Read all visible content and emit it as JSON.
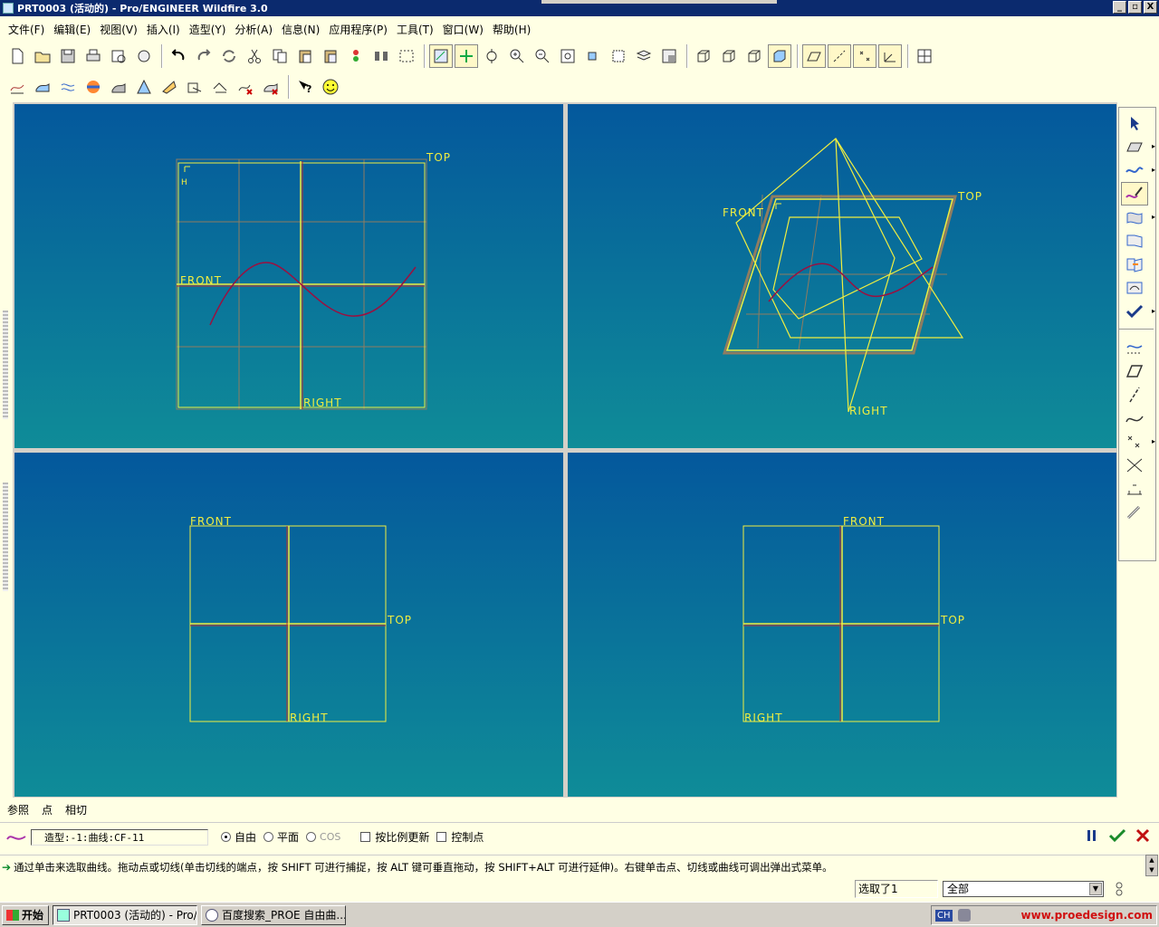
{
  "window": {
    "title": "PRT0003 (活动的) - Pro/ENGINEER Wildfire 3.0",
    "controls": [
      "_",
      "▫",
      "X"
    ]
  },
  "menu": [
    "文件(F)",
    "编辑(E)",
    "视图(V)",
    "插入(I)",
    "造型(Y)",
    "分析(A)",
    "信息(N)",
    "应用程序(P)",
    "工具(T)",
    "窗口(W)",
    "帮助(H)"
  ],
  "toolbar_icons": {
    "row1": [
      "new-file",
      "open-file",
      "save",
      "print",
      "print-preview",
      "email",
      "undo",
      "redo",
      "regenerate",
      "cut",
      "copy",
      "paste",
      "paste-special",
      "regenerate-model",
      "find",
      "selection-box",
      "refit",
      "repaint",
      "orient",
      "zoom-in",
      "zoom-out",
      "zoom-fit",
      "spin-center",
      "named-view",
      "layers",
      "view-manager",
      "wireframe",
      "hidden-line",
      "no-hidden",
      "shaded",
      "datum-planes",
      "datum-axes",
      "datum-points",
      "coordinate-systems",
      "views-split"
    ],
    "row2": [
      "curve-analysis",
      "surface-analysis",
      "curvature",
      "reflection",
      "draft",
      "slope",
      "section",
      "dihedral",
      "deviation",
      "offset",
      "connection",
      "whats-this",
      "smiley"
    ],
    "right": [
      "select-arrow",
      "datum-plane",
      "create-curve",
      "edit-curve",
      "create-surface",
      "surface-edit",
      "connect-surfaces",
      "trim-surface",
      "done-check",
      "curve-from-surface",
      "plane",
      "line",
      "sweep-curve",
      "points",
      "offset-points",
      "dimension",
      "analysis-link"
    ]
  },
  "viewports": {
    "top_left": {
      "labels": {
        "top": "TOP",
        "front": "FRONT",
        "right": "RIGHT"
      },
      "axis_marker": "H"
    },
    "top_right": {
      "labels": {
        "top": "TOP",
        "front": "FRONT",
        "right": "RIGHT"
      }
    },
    "bottom_left": {
      "labels": {
        "front": "FRONT",
        "top": "TOP",
        "right": "RIGHT"
      }
    },
    "bottom_right": {
      "labels": {
        "front": "FRONT",
        "top": "TOP",
        "right": "RIGHT"
      }
    }
  },
  "dashboard": {
    "tabs": [
      "参照",
      "点",
      "相切"
    ],
    "curve_field": "造型:-1:曲线:CF-11",
    "options": [
      {
        "label": "自由",
        "selected": true
      },
      {
        "label": "平面",
        "selected": false
      },
      {
        "label": "COS",
        "selected": false,
        "disabled": true
      }
    ],
    "checkboxes": [
      {
        "label": "按比例更新",
        "checked": false
      },
      {
        "label": "控制点",
        "checked": false
      }
    ],
    "actions": [
      "pause",
      "accept",
      "cancel"
    ]
  },
  "message": "通过单击来选取曲线。拖动点或切线(单击切线的端点，按 SHIFT 可进行捕捉，按 ALT 键可垂直拖动，按 SHIFT+ALT 可进行延伸)。右键单击点、切线或曲线可调出弹出式菜单。",
  "status": {
    "selected": "选取了1",
    "filter": "全部"
  },
  "taskbar": {
    "start": "开始",
    "tasks": [
      {
        "label": "PRT0003 (活动的) - Pro/...",
        "active": true
      },
      {
        "label": "百度搜索_PROE 自由曲...",
        "active": false
      }
    ],
    "tray": {
      "ime": "CH",
      "watermark": "www.proedesign.com"
    }
  },
  "colors": {
    "background": "#ffffe4",
    "viewport_top": "#04589c",
    "viewport_bottom": "#0f8c98",
    "datum": "#f0ee40",
    "curve": "#9b1040",
    "titlebar": "#0b2a6e"
  }
}
